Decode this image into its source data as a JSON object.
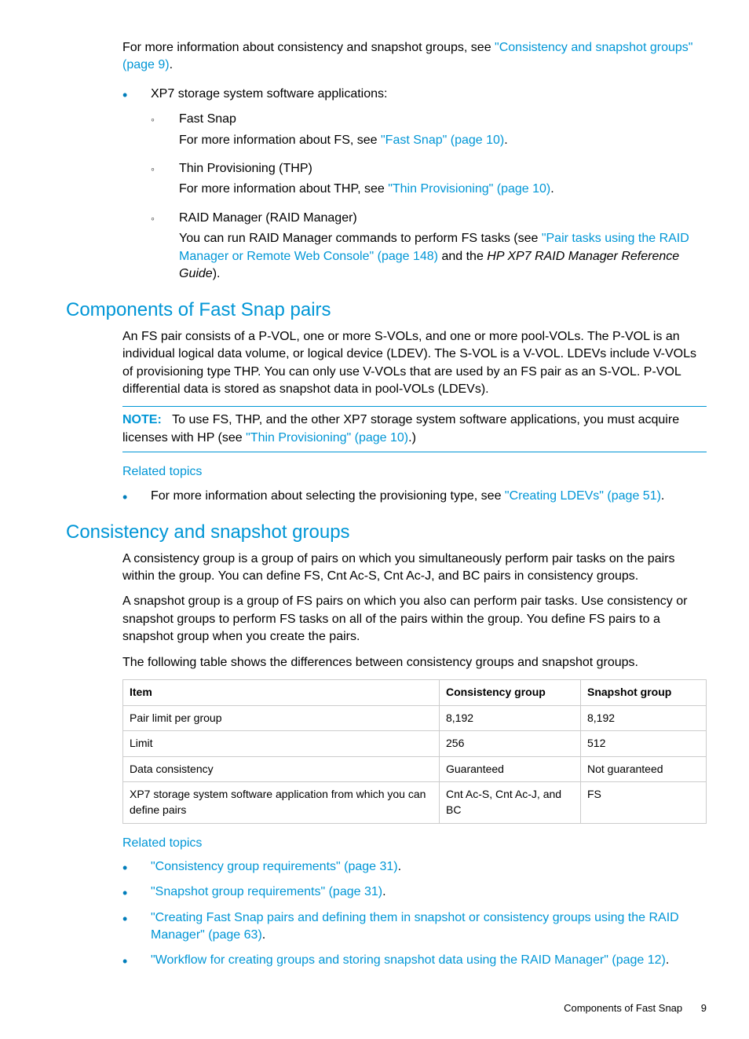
{
  "top": {
    "intro_text_pre": "For more information about consistency and snapshot groups, see ",
    "intro_link": "\"Consistency and snapshot groups\" (page 9)",
    "intro_text_post": ".",
    "bullet1": "XP7 storage system software applications:",
    "sub": {
      "fs_title": "Fast Snap",
      "fs_pre": "For more information about FS, see ",
      "fs_link": "\"Fast Snap\" (page 10)",
      "fs_post": ".",
      "thp_title": "Thin Provisioning (THP)",
      "thp_pre": "For more information about THP, see ",
      "thp_link": "\"Thin Provisioning\" (page 10)",
      "thp_post": ".",
      "rm_title": "RAID Manager (RAID Manager)",
      "rm_pre": "You can run RAID Manager commands to perform FS tasks (see ",
      "rm_link": "\"Pair tasks using the RAID Manager or Remote Web Console\" (page 148)",
      "rm_mid": " and the ",
      "rm_italic": "HP XP7 RAID Manager Reference Guide",
      "rm_post": ")."
    }
  },
  "components": {
    "heading": "Components of Fast Snap pairs",
    "p1": "An FS pair consists of a P-VOL, one or more S-VOLs, and one or more pool-VOLs. The P-VOL is an individual logical data volume, or logical device (LDEV). The S-VOL is a V-VOL. LDEVs include V-VOLs of provisioning type THP. You can only use V-VOLs that are used by an FS pair as an S-VOL. P-VOL differential data is stored as snapshot data in pool-VOLs (LDEVs).",
    "note_label": "NOTE:",
    "note_pre": "To use FS, THP, and the other XP7 storage system software applications, you must acquire licenses with HP (see ",
    "note_link": "\"Thin Provisioning\" (page 10)",
    "note_post": ".)",
    "related_heading": "Related topics",
    "related_pre": "For more information about selecting the provisioning type, see ",
    "related_link": "\"Creating LDEVs\" (page 51)",
    "related_post": "."
  },
  "consistency": {
    "heading": "Consistency and snapshot groups",
    "p1": "A consistency group is a group of pairs on which you simultaneously perform pair tasks on the pairs within the group. You can define FS, Cnt Ac-S, Cnt Ac-J, and BC pairs in consistency groups.",
    "p2": "A snapshot group is a group of FS pairs on which you also can perform pair tasks. Use consistency or snapshot groups to perform FS tasks on all of the pairs within the group. You define FS pairs to a snapshot group when you create the pairs.",
    "p3": "The following table shows the differences between consistency groups and snapshot groups.",
    "table": {
      "headers": [
        "Item",
        "Consistency group",
        "Snapshot group"
      ],
      "rows": [
        [
          "Pair limit per group",
          "8,192",
          "8,192"
        ],
        [
          "Limit",
          "256",
          "512"
        ],
        [
          "Data consistency",
          "Guaranteed",
          "Not guaranteed"
        ],
        [
          "XP7 storage system software application from which you can define pairs",
          "Cnt Ac-S, Cnt Ac-J, and BC",
          "FS"
        ]
      ]
    },
    "related_heading": "Related topics",
    "links": [
      {
        "text": "\"Consistency group requirements\" (page 31)",
        "post": "."
      },
      {
        "text": "\"Snapshot group requirements\" (page 31)",
        "post": "."
      },
      {
        "text": "\"Creating Fast Snap pairs and defining them in snapshot or consistency groups using the RAID Manager\" (page 63)",
        "post": "."
      },
      {
        "text": "\"Workflow for creating groups and storing snapshot data using the RAID Manager\" (page 12)",
        "post": "."
      }
    ]
  },
  "footer": {
    "section": "Components of Fast Snap",
    "page": "9"
  }
}
